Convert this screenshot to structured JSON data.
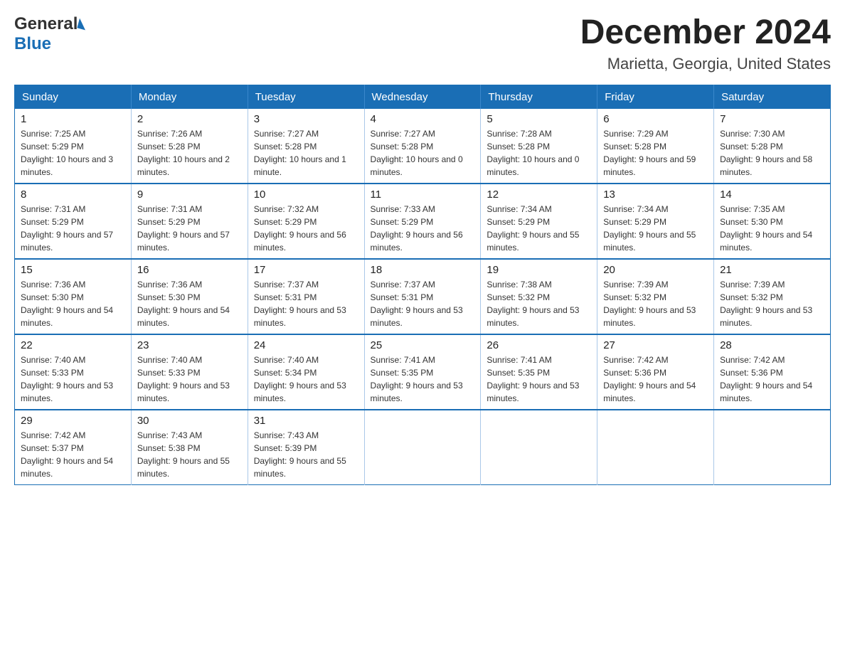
{
  "header": {
    "title": "December 2024",
    "subtitle": "Marietta, Georgia, United States",
    "logo_line1": "General",
    "logo_line2": "Blue"
  },
  "days_of_week": [
    "Sunday",
    "Monday",
    "Tuesday",
    "Wednesday",
    "Thursday",
    "Friday",
    "Saturday"
  ],
  "weeks": [
    [
      {
        "day": "1",
        "sunrise": "7:25 AM",
        "sunset": "5:29 PM",
        "daylight": "10 hours and 3 minutes."
      },
      {
        "day": "2",
        "sunrise": "7:26 AM",
        "sunset": "5:28 PM",
        "daylight": "10 hours and 2 minutes."
      },
      {
        "day": "3",
        "sunrise": "7:27 AM",
        "sunset": "5:28 PM",
        "daylight": "10 hours and 1 minute."
      },
      {
        "day": "4",
        "sunrise": "7:27 AM",
        "sunset": "5:28 PM",
        "daylight": "10 hours and 0 minutes."
      },
      {
        "day": "5",
        "sunrise": "7:28 AM",
        "sunset": "5:28 PM",
        "daylight": "10 hours and 0 minutes."
      },
      {
        "day": "6",
        "sunrise": "7:29 AM",
        "sunset": "5:28 PM",
        "daylight": "9 hours and 59 minutes."
      },
      {
        "day": "7",
        "sunrise": "7:30 AM",
        "sunset": "5:28 PM",
        "daylight": "9 hours and 58 minutes."
      }
    ],
    [
      {
        "day": "8",
        "sunrise": "7:31 AM",
        "sunset": "5:29 PM",
        "daylight": "9 hours and 57 minutes."
      },
      {
        "day": "9",
        "sunrise": "7:31 AM",
        "sunset": "5:29 PM",
        "daylight": "9 hours and 57 minutes."
      },
      {
        "day": "10",
        "sunrise": "7:32 AM",
        "sunset": "5:29 PM",
        "daylight": "9 hours and 56 minutes."
      },
      {
        "day": "11",
        "sunrise": "7:33 AM",
        "sunset": "5:29 PM",
        "daylight": "9 hours and 56 minutes."
      },
      {
        "day": "12",
        "sunrise": "7:34 AM",
        "sunset": "5:29 PM",
        "daylight": "9 hours and 55 minutes."
      },
      {
        "day": "13",
        "sunrise": "7:34 AM",
        "sunset": "5:29 PM",
        "daylight": "9 hours and 55 minutes."
      },
      {
        "day": "14",
        "sunrise": "7:35 AM",
        "sunset": "5:30 PM",
        "daylight": "9 hours and 54 minutes."
      }
    ],
    [
      {
        "day": "15",
        "sunrise": "7:36 AM",
        "sunset": "5:30 PM",
        "daylight": "9 hours and 54 minutes."
      },
      {
        "day": "16",
        "sunrise": "7:36 AM",
        "sunset": "5:30 PM",
        "daylight": "9 hours and 54 minutes."
      },
      {
        "day": "17",
        "sunrise": "7:37 AM",
        "sunset": "5:31 PM",
        "daylight": "9 hours and 53 minutes."
      },
      {
        "day": "18",
        "sunrise": "7:37 AM",
        "sunset": "5:31 PM",
        "daylight": "9 hours and 53 minutes."
      },
      {
        "day": "19",
        "sunrise": "7:38 AM",
        "sunset": "5:32 PM",
        "daylight": "9 hours and 53 minutes."
      },
      {
        "day": "20",
        "sunrise": "7:39 AM",
        "sunset": "5:32 PM",
        "daylight": "9 hours and 53 minutes."
      },
      {
        "day": "21",
        "sunrise": "7:39 AM",
        "sunset": "5:32 PM",
        "daylight": "9 hours and 53 minutes."
      }
    ],
    [
      {
        "day": "22",
        "sunrise": "7:40 AM",
        "sunset": "5:33 PM",
        "daylight": "9 hours and 53 minutes."
      },
      {
        "day": "23",
        "sunrise": "7:40 AM",
        "sunset": "5:33 PM",
        "daylight": "9 hours and 53 minutes."
      },
      {
        "day": "24",
        "sunrise": "7:40 AM",
        "sunset": "5:34 PM",
        "daylight": "9 hours and 53 minutes."
      },
      {
        "day": "25",
        "sunrise": "7:41 AM",
        "sunset": "5:35 PM",
        "daylight": "9 hours and 53 minutes."
      },
      {
        "day": "26",
        "sunrise": "7:41 AM",
        "sunset": "5:35 PM",
        "daylight": "9 hours and 53 minutes."
      },
      {
        "day": "27",
        "sunrise": "7:42 AM",
        "sunset": "5:36 PM",
        "daylight": "9 hours and 54 minutes."
      },
      {
        "day": "28",
        "sunrise": "7:42 AM",
        "sunset": "5:36 PM",
        "daylight": "9 hours and 54 minutes."
      }
    ],
    [
      {
        "day": "29",
        "sunrise": "7:42 AM",
        "sunset": "5:37 PM",
        "daylight": "9 hours and 54 minutes."
      },
      {
        "day": "30",
        "sunrise": "7:43 AM",
        "sunset": "5:38 PM",
        "daylight": "9 hours and 55 minutes."
      },
      {
        "day": "31",
        "sunrise": "7:43 AM",
        "sunset": "5:39 PM",
        "daylight": "9 hours and 55 minutes."
      },
      null,
      null,
      null,
      null
    ]
  ]
}
